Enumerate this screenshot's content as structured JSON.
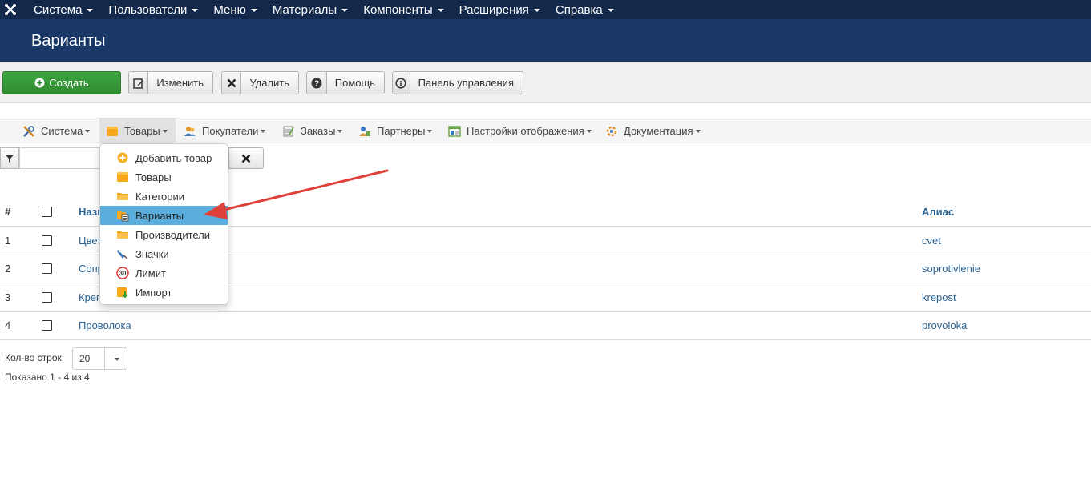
{
  "topnav": {
    "items": [
      {
        "label": "Система"
      },
      {
        "label": "Пользователи"
      },
      {
        "label": "Меню"
      },
      {
        "label": "Материалы"
      },
      {
        "label": "Компоненты"
      },
      {
        "label": "Расширения"
      },
      {
        "label": "Справка"
      }
    ]
  },
  "header": {
    "title": "Варианты"
  },
  "toolbar": {
    "create": "Создать",
    "edit": "Изменить",
    "delete": "Удалить",
    "help": "Помощь",
    "dashboard": "Панель управления"
  },
  "submenu": {
    "items": [
      {
        "label": "Система",
        "icon": "tools-icon"
      },
      {
        "label": "Товары",
        "icon": "box-icon"
      },
      {
        "label": "Покупатели",
        "icon": "users-icon"
      },
      {
        "label": "Заказы",
        "icon": "orders-icon"
      },
      {
        "label": "Партнеры",
        "icon": "partners-icon"
      },
      {
        "label": "Настройки отображения",
        "icon": "display-settings-icon"
      },
      {
        "label": "Документация",
        "icon": "docs-icon"
      }
    ]
  },
  "dropdown": {
    "items": [
      {
        "label": "Добавить товар",
        "icon": "add-icon"
      },
      {
        "label": "Товары",
        "icon": "box-icon"
      },
      {
        "label": "Категории",
        "icon": "folder-icon"
      },
      {
        "label": "Варианты",
        "icon": "variants-icon",
        "active": true
      },
      {
        "label": "Производители",
        "icon": "folder-icon"
      },
      {
        "label": "Значки",
        "icon": "badge-icon"
      },
      {
        "label": "Лимит",
        "icon": "limit-icon"
      },
      {
        "label": "Импорт",
        "icon": "import-icon"
      }
    ]
  },
  "filter": {
    "value": ""
  },
  "table": {
    "headers": {
      "num": "#",
      "name": "Назв",
      "alias": "Алиас"
    },
    "rows": [
      {
        "num": "1",
        "name": "Цвет",
        "alias": "cvet"
      },
      {
        "num": "2",
        "name": "Сопр",
        "alias": "soprotivlenie"
      },
      {
        "num": "3",
        "name": "Креп",
        "alias": "krepost"
      },
      {
        "num": "4",
        "name": "Проволока",
        "alias": "provoloka"
      }
    ]
  },
  "footer": {
    "limit_label": "Кол-во строк:",
    "limit_value": "20",
    "shown": "Показано 1 - 4 из 4"
  },
  "colors": {
    "topnav": "#13294b",
    "header": "#1a3867",
    "success": "#2e8b30",
    "link": "#2a6496",
    "active_item": "#5aaede",
    "arrow": "#e0403a"
  }
}
